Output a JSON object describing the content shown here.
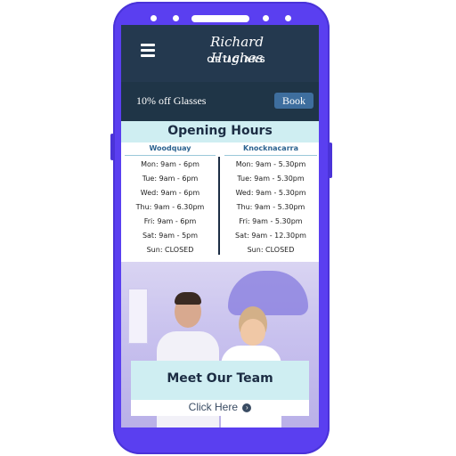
{
  "brand": {
    "name": "Richard Hughes",
    "subtitle": "OPTICIANS"
  },
  "promo": {
    "text": "10% off Glasses",
    "book_label": "Book"
  },
  "hours": {
    "title": "Opening Hours",
    "locations": [
      {
        "name": "Woodquay",
        "days": [
          "Mon: 9am - 6pm",
          "Tue: 9am - 6pm",
          "Wed: 9am - 6pm",
          "Thu: 9am - 6.30pm",
          "Fri: 9am - 6pm",
          "Sat: 9am - 5pm",
          "Sun: CLOSED"
        ]
      },
      {
        "name": "Knocknacarra",
        "days": [
          "Mon: 9am - 5.30pm",
          "Tue: 9am - 5.30pm",
          "Wed: 9am - 5.30pm",
          "Thu: 9am - 5.30pm",
          "Fri: 9am - 5.30pm",
          "Sat: 9am - 12.30pm",
          "Sun: CLOSED"
        ]
      }
    ]
  },
  "team": {
    "title": "Meet Our Team",
    "cta": "Click Here"
  },
  "colors": {
    "phone": "#5a3ff0",
    "navbar": "#24394f",
    "accent": "#cfeef2",
    "book": "#3e6e9e"
  },
  "icons": {
    "menu": "hamburger-icon",
    "cta": "arrow-circle-right-icon"
  }
}
